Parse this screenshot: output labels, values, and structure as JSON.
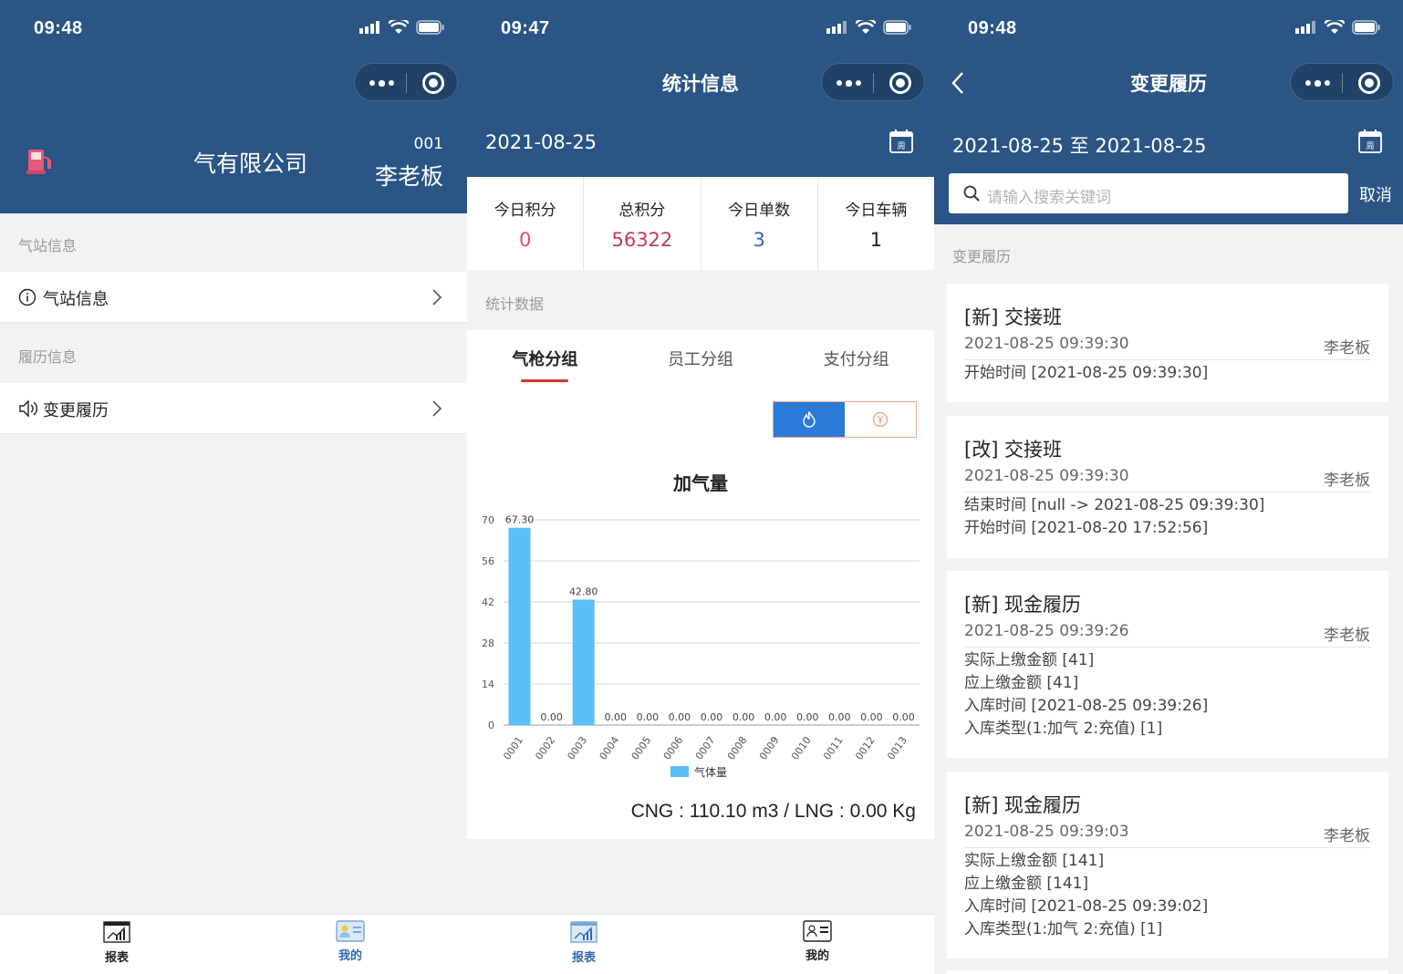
{
  "theme": {
    "primary": "#2a5585",
    "accent_red": "#d9342b",
    "chart_bar": "#5bbef5",
    "value_pink": "#e04d6b",
    "value_crimson": "#c23a5a",
    "value_blue": "#2e6ab0"
  },
  "screen1": {
    "status": {
      "time": "09:48"
    },
    "header": {
      "company": "气有限公司",
      "code": "001",
      "owner": "李老板"
    },
    "sections": [
      {
        "label": "气站信息",
        "item": {
          "icon": "info-circle-icon",
          "label": "气站信息"
        }
      },
      {
        "label": "履历信息",
        "item": {
          "icon": "speaker-icon",
          "label": "变更履历"
        }
      }
    ],
    "tabbar": [
      {
        "label": "报表",
        "icon": "report-chart-icon"
      },
      {
        "label": "我的",
        "icon": "id-card-icon",
        "active": true
      }
    ]
  },
  "screen2": {
    "status": {
      "time": "09:47"
    },
    "title": "统计信息",
    "date": "2021-08-25",
    "calendar_label": "周",
    "stats": [
      {
        "label": "今日积分",
        "value": "0"
      },
      {
        "label": "总积分",
        "value": "56322"
      },
      {
        "label": "今日单数",
        "value": "3"
      },
      {
        "label": "今日车辆",
        "value": "1"
      }
    ],
    "section_label": "统计数据",
    "tabs": [
      "气枪分组",
      "员工分组",
      "支付分组"
    ],
    "segment_icons": [
      "flame-icon",
      "yen-coin-icon"
    ],
    "chart_title": "加气量",
    "chart_footer": "CNG : 110.10 m3 / LNG : 0.00 Kg",
    "tabbar": [
      {
        "label": "报表",
        "icon": "report-chart-icon",
        "active": true
      },
      {
        "label": "我的",
        "icon": "id-card-icon"
      }
    ]
  },
  "chart_data": {
    "type": "bar",
    "title": "加气量",
    "categories": [
      "0001",
      "0002",
      "0003",
      "0004",
      "0005",
      "0006",
      "0007",
      "0008",
      "0009",
      "0010",
      "0011",
      "0012",
      "0013"
    ],
    "series": [
      {
        "name": "气体量",
        "values": [
          67.3,
          0.0,
          42.8,
          0.0,
          0.0,
          0.0,
          0.0,
          0.0,
          0.0,
          0.0,
          0.0,
          0.0,
          0.0
        ]
      }
    ],
    "value_labels": [
      "67.30",
      "0.00",
      "42.80",
      "0.00",
      "0.00",
      "0.00",
      "0.00",
      "0.00",
      "0.00",
      "0.00",
      "0.00",
      "0.00",
      "0.00"
    ],
    "yticks": [
      0,
      14,
      28,
      42,
      56,
      70
    ],
    "ylim": [
      0,
      70
    ],
    "grid": true,
    "legend": "bottom-center"
  },
  "screen3": {
    "status": {
      "time": "09:48"
    },
    "title": "变更履历",
    "date_range": "2021-08-25 至 2021-08-25",
    "calendar_label": "周",
    "search_placeholder": "请输入搜索关键词",
    "cancel": "取消",
    "section_label": "变更履历",
    "records": [
      {
        "title": "[新] 交接班",
        "time": "2021-08-25 09:39:30",
        "user": "李老板",
        "lines": [
          "开始时间 [2021-08-25 09:39:30]"
        ]
      },
      {
        "title": "[改] 交接班",
        "time": "2021-08-25 09:39:30",
        "user": "李老板",
        "lines": [
          "结束时间 [null -> 2021-08-25 09:39:30]",
          "开始时间 [2021-08-20 17:52:56]"
        ]
      },
      {
        "title": "[新] 现金履历",
        "time": "2021-08-25 09:39:26",
        "user": "李老板",
        "lines": [
          "实际上缴金额 [41]",
          "应上缴金额 [41]",
          "入库时间 [2021-08-25 09:39:26]",
          "入库类型(1:加气 2:充值) [1]"
        ]
      },
      {
        "title": "[新] 现金履历",
        "time": "2021-08-25 09:39:03",
        "user": "李老板",
        "lines": [
          "实际上缴金额 [141]",
          "应上缴金额 [141]",
          "入库时间 [2021-08-25 09:39:02]",
          "入库类型(1:加气 2:充值) [1]"
        ]
      }
    ]
  }
}
